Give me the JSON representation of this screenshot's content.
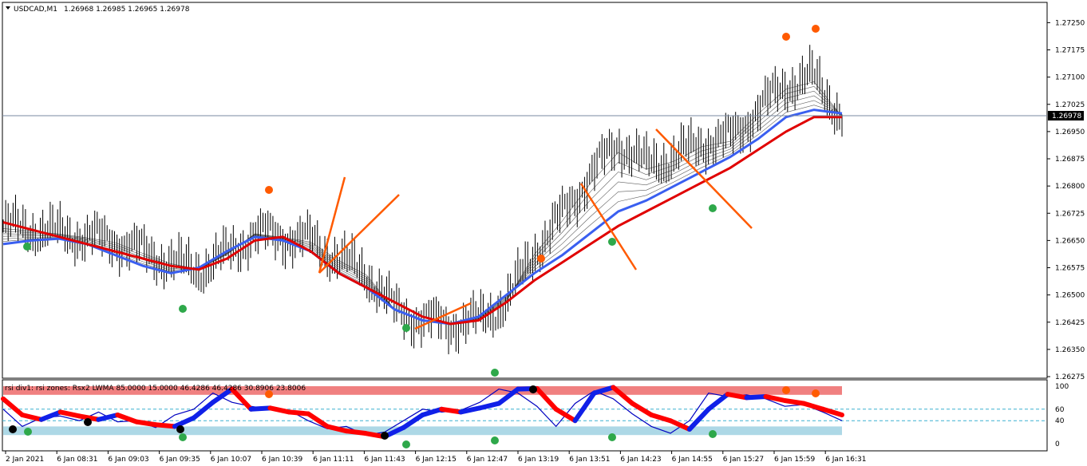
{
  "main_header": {
    "symbol": "USDCAD,M1",
    "ohlc": "1.26968 1.26985 1.26965 1.26978"
  },
  "indicator_header": "rsi div1: rsi zones: Rsx2 LWMA 85.0000 15.0000 46.4286 46.4286 30.8906 23.8006",
  "current_price_label": "1.26978",
  "colors": {
    "bull_ma": "#e00000",
    "blue_ma": "#3a5ff0",
    "fan": "#1a1a1a",
    "trend": "#ff5a00",
    "up_arrow": "#2ea84a",
    "down_arrow": "#ff5a00",
    "zone_high": "#f08080",
    "zone_low": "#add8e6",
    "grid_dash": "#3ab0d0"
  },
  "chart_data": [
    {
      "type": "line",
      "title": "",
      "ylim": [
        1.26275,
        1.27275
      ],
      "y_ticks": [
        "1.27250",
        "1.27175",
        "1.27100",
        "1.27025",
        "1.26950",
        "1.26875",
        "1.26800",
        "1.26725",
        "1.26650",
        "1.26575",
        "1.26500",
        "1.26425",
        "1.26350",
        "1.26275"
      ],
      "current_price": 1.26978,
      "series": [
        {
          "values": [
            1.2669,
            1.2668,
            1.2667,
            1.2666,
            1.2665,
            1.2662,
            1.2659,
            1.2657,
            1.2661,
            1.2667,
            1.2666,
            1.2665,
            1.266,
            1.2656,
            1.2646,
            1.2643,
            1.2642,
            1.2643,
            1.2648,
            1.2662,
            1.2672,
            1.2683,
            1.2692,
            1.2686,
            1.2688,
            1.2692,
            1.2693,
            1.2701,
            1.2708,
            1.271,
            1.2699
          ]
        },
        {
          "values": [
            1.2664,
            1.2665,
            1.26655,
            1.2664,
            1.2661,
            1.2658,
            1.2656,
            1.26575,
            1.2662,
            1.2666,
            1.2665,
            1.2662,
            1.2656,
            1.2652,
            1.2646,
            1.2643,
            1.2642,
            1.2644,
            1.265,
            1.2656,
            1.2661,
            1.2667,
            1.2673,
            1.2676,
            1.268,
            1.2684,
            1.2688,
            1.2693,
            1.2699,
            1.2701,
            1.27
          ]
        },
        {
          "values": [
            1.267,
            1.2668,
            1.2666,
            1.2664,
            1.2662,
            1.266,
            1.2658,
            1.2657,
            1.266,
            1.2665,
            1.2666,
            1.2662,
            1.2656,
            1.2652,
            1.2648,
            1.2644,
            1.2642,
            1.2643,
            1.2648,
            1.2654,
            1.2659,
            1.2664,
            1.2669,
            1.2673,
            1.2677,
            1.2681,
            1.2685,
            1.269,
            1.2695,
            1.2699,
            1.2699
          ]
        }
      ]
    },
    {
      "type": "line",
      "title": "",
      "ylim": [
        0,
        100
      ],
      "y_ticks": [
        "100",
        "60",
        "40",
        "0"
      ],
      "zones": {
        "high": [
          85,
          100
        ],
        "low": [
          15,
          30
        ]
      },
      "levels": [
        60,
        40
      ],
      "series": [
        {
          "values": [
            78,
            50,
            42,
            55,
            48,
            42,
            50,
            38,
            33,
            30,
            45,
            72,
            95,
            60,
            62,
            55,
            52,
            30,
            22,
            18,
            12,
            28,
            50,
            60,
            55,
            62,
            70,
            95,
            96,
            60,
            40,
            88,
            98,
            70,
            50,
            40,
            25,
            60,
            86,
            80,
            82,
            75,
            70,
            60,
            50
          ]
        },
        {
          "values": [
            60,
            30,
            45,
            48,
            40,
            55,
            38,
            40,
            28,
            50,
            60,
            88,
            72,
            65,
            60,
            58,
            40,
            26,
            30,
            15,
            20,
            40,
            60,
            55,
            58,
            72,
            95,
            88,
            65,
            30,
            70,
            92,
            78,
            52,
            30,
            18,
            40,
            88,
            82,
            85,
            78,
            65,
            68,
            55,
            40
          ]
        }
      ]
    }
  ],
  "x_labels": [
    "2 Jan 2021",
    "6 Jan 08:31",
    "6 Jan 09:03",
    "6 Jan 09:35",
    "6 Jan 10:07",
    "6 Jan 10:39",
    "6 Jan 11:11",
    "6 Jan 11:43",
    "6 Jan 12:15",
    "6 Jan 12:47",
    "6 Jan 13:19",
    "6 Jan 13:51",
    "6 Jan 14:23",
    "6 Jan 14:55",
    "6 Jan 15:27",
    "6 Jan 15:59",
    "6 Jan 16:31"
  ]
}
